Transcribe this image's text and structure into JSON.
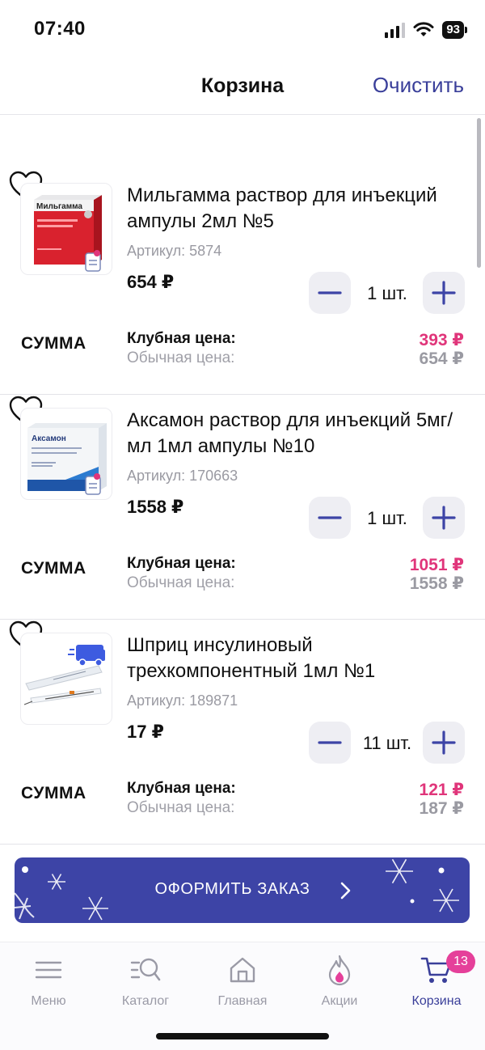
{
  "status_bar": {
    "time": "07:40",
    "battery": "93"
  },
  "header": {
    "title": "Корзина",
    "clear_label": "Очистить"
  },
  "items": [
    {
      "name": "Мильгамма раствор для инъекций ампулы 2мл №5",
      "sku": "Артикул: 5874",
      "price": "654 ₽",
      "quantity": "1 шт.",
      "sum_label": "СУММА",
      "club_label": "Клубная цена:",
      "regular_label": "Обычная цена:",
      "club_price": "393 ₽",
      "regular_price": "654 ₽",
      "pack_brand": "Мильгамма"
    },
    {
      "name": "Аксамон раствор для инъекций 5мг/мл 1мл ампулы №10",
      "sku": "Артикул: 170663",
      "price": "1558 ₽",
      "quantity": "1 шт.",
      "sum_label": "СУММА",
      "club_label": "Клубная цена:",
      "regular_label": "Обычная цена:",
      "club_price": "1051 ₽",
      "regular_price": "1558 ₽",
      "pack_brand": "Аксамон"
    },
    {
      "name": "Шприц инсулиновый трехкомпонентный 1мл №1",
      "sku": "Артикул: 189871",
      "price": "17 ₽",
      "quantity": "11 шт.",
      "sum_label": "СУММА",
      "club_label": "Клубная цена:",
      "regular_label": "Обычная цена:",
      "club_price": "121 ₽",
      "regular_price": "187 ₽"
    }
  ],
  "checkout": {
    "label": "ОФОРМИТЬ ЗАКАЗ"
  },
  "tab_bar": {
    "tabs": [
      {
        "label": "Меню",
        "icon": "menu-icon"
      },
      {
        "label": "Каталог",
        "icon": "catalog-search-icon"
      },
      {
        "label": "Главная",
        "icon": "home-icon"
      },
      {
        "label": "Акции",
        "icon": "flame-icon"
      },
      {
        "label": "Корзина",
        "icon": "cart-icon",
        "active": true,
        "badge": "13"
      }
    ]
  },
  "colors": {
    "accent": "#3d44a6",
    "club_price": "#e0357a",
    "badge": "#e5409a",
    "muted": "#9a9aa2"
  }
}
